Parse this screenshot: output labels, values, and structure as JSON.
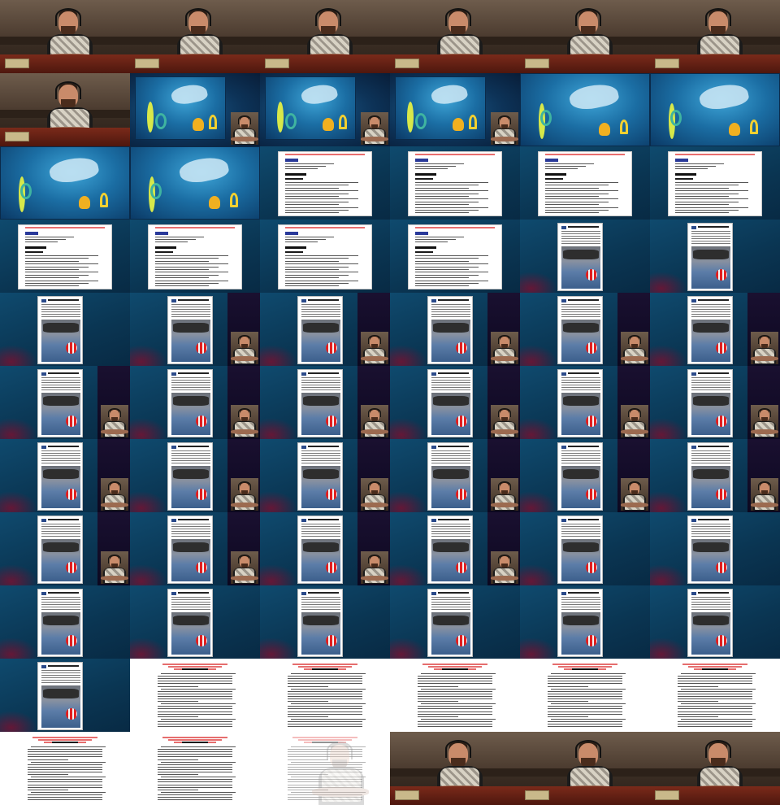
{
  "grid": {
    "columns": 6,
    "rows": 11
  },
  "icons": {
    "person": "person-silhouette-icon",
    "headset": "headset-icon",
    "buoy": "buoy-icon",
    "shipwreck": "shipwreck-icon"
  },
  "colors": {
    "underwater_text": "#ffe14a",
    "slide_background": "#0a3552",
    "document_heading_red": "#e34a4a"
  },
  "frames": [
    {
      "kind": "speaker"
    },
    {
      "kind": "speaker"
    },
    {
      "kind": "speaker"
    },
    {
      "kind": "speaker"
    },
    {
      "kind": "speaker"
    },
    {
      "kind": "speaker"
    },
    {
      "kind": "speaker"
    },
    {
      "kind": "underwater",
      "pip": true
    },
    {
      "kind": "underwater",
      "pip": true
    },
    {
      "kind": "underwater",
      "pip": true
    },
    {
      "kind": "underwater",
      "full": true
    },
    {
      "kind": "underwater",
      "full": true
    },
    {
      "kind": "underwater",
      "full": true
    },
    {
      "kind": "underwater",
      "full": true
    },
    {
      "kind": "docpage"
    },
    {
      "kind": "docpage"
    },
    {
      "kind": "docpage"
    },
    {
      "kind": "docpage"
    },
    {
      "kind": "docpage"
    },
    {
      "kind": "docpage"
    },
    {
      "kind": "docpage"
    },
    {
      "kind": "docpage"
    },
    {
      "kind": "article"
    },
    {
      "kind": "article"
    },
    {
      "kind": "article"
    },
    {
      "kind": "article",
      "pip": true
    },
    {
      "kind": "article",
      "pip": true
    },
    {
      "kind": "article",
      "pip": true
    },
    {
      "kind": "article",
      "pip": true
    },
    {
      "kind": "article",
      "pip": true
    },
    {
      "kind": "article",
      "pip": true
    },
    {
      "kind": "article",
      "pip": true
    },
    {
      "kind": "article",
      "pip": true
    },
    {
      "kind": "article",
      "pip": true
    },
    {
      "kind": "article",
      "pip": true
    },
    {
      "kind": "article",
      "pip": true
    },
    {
      "kind": "article",
      "pip": true
    },
    {
      "kind": "article",
      "pip": true
    },
    {
      "kind": "article",
      "pip": true
    },
    {
      "kind": "article",
      "pip": true
    },
    {
      "kind": "article",
      "pip": true
    },
    {
      "kind": "article",
      "pip": true
    },
    {
      "kind": "article",
      "pip": true
    },
    {
      "kind": "article",
      "pip": true
    },
    {
      "kind": "article",
      "pip": true
    },
    {
      "kind": "article",
      "pip": true
    },
    {
      "kind": "article"
    },
    {
      "kind": "article"
    },
    {
      "kind": "article"
    },
    {
      "kind": "article"
    },
    {
      "kind": "article"
    },
    {
      "kind": "article"
    },
    {
      "kind": "article"
    },
    {
      "kind": "article"
    },
    {
      "kind": "article"
    },
    {
      "kind": "textpage"
    },
    {
      "kind": "textpage"
    },
    {
      "kind": "textpage"
    },
    {
      "kind": "textpage"
    },
    {
      "kind": "textpage"
    },
    {
      "kind": "textpage"
    },
    {
      "kind": "textpage"
    },
    {
      "kind": "textpage",
      "fade": true
    },
    {
      "kind": "speaker"
    },
    {
      "kind": "speaker"
    },
    {
      "kind": "speaker"
    }
  ]
}
